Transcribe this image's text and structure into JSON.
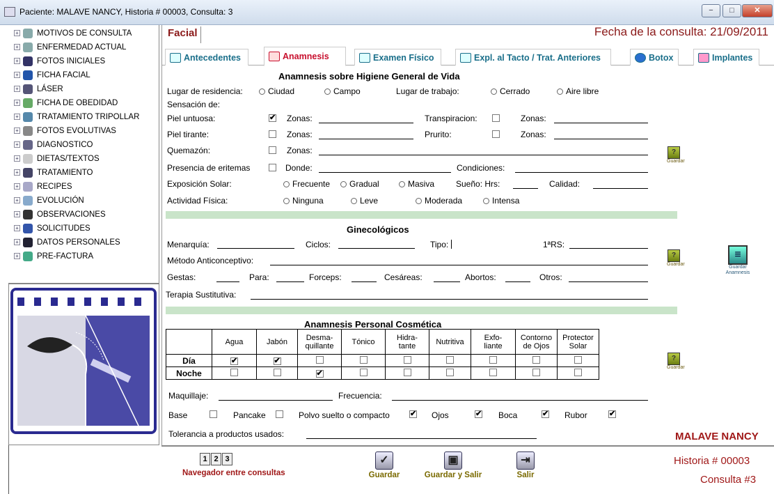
{
  "window": {
    "title": "Paciente: MALAVE  NANCY, Historia # 00003, Consulta: 3",
    "min": "−",
    "max": "□",
    "close": "✕"
  },
  "sidebar": {
    "items": [
      "MOTIVOS DE CONSULTA",
      "ENFERMEDAD ACTUAL",
      "FOTOS INICIALES",
      "FICHA FACIAL",
      "LÁSER",
      "FICHA DE OBEDIDAD",
      "TRATAMIENTO TRIPOLLAR",
      "FOTOS EVOLUTIVAS",
      "DIAGNOSTICO",
      "DIETAS/TEXTOS",
      "TRATAMIENTO",
      "RECIPES",
      "EVOLUCIÓN",
      "OBSERVACIONES",
      "SOLICITUDES",
      "DATOS PERSONALES",
      "PRE-FACTURA"
    ],
    "icons": [
      "person-icon",
      "person-icon",
      "photo-icon",
      "face-icon",
      "laser-icon",
      "scale-icon",
      "device-icon",
      "photo-icon",
      "pen-icon",
      "apple-icon",
      "check-icon",
      "doc-icon",
      "doc-icon",
      "notes-icon",
      "form-icon",
      "info-icon",
      "invoice-icon"
    ]
  },
  "header": {
    "tab": "Facial",
    "fecha_label": "Fecha de la consulta:",
    "fecha": "21/09/2011"
  },
  "tabs": [
    "Antecedentes",
    "Anamnesis",
    "Examen Físico",
    "Expl. al Tacto / Trat. Anteriores",
    "Botox",
    "Implantes"
  ],
  "higiene": {
    "title": "Anamnesis sobre Higiene General de Vida",
    "residencia": "Lugar de residencia:",
    "ciudad": "Ciudad",
    "campo": "Campo",
    "trabajo": "Lugar de trabajo:",
    "cerrado": "Cerrado",
    "aire": "Aire libre",
    "sensacion": "Sensación de:",
    "piel_untuosa": "Piel untuosa:",
    "zonas": "Zonas:",
    "transpiracion": "Transpiracion:",
    "piel_tirante": "Piel tirante:",
    "prurito": "Prurito:",
    "quemazon": "Quemazón:",
    "eritemas": "Presencia de eritemas",
    "donde": "Donde:",
    "condiciones": "Condiciones:",
    "exposicion": "Exposición Solar:",
    "frecuente": "Frecuente",
    "gradual": "Gradual",
    "masiva": "Masiva",
    "sueno": "Sueño: Hrs:",
    "calidad": "Calidad:",
    "actividad": "Actividad Física:",
    "ninguna": "Ninguna",
    "leve": "Leve",
    "moderada": "Moderada",
    "intensa": "Intensa"
  },
  "gineco": {
    "title": "Ginecológicos",
    "menarquia": "Menarquía:",
    "ciclos": "Ciclos:",
    "tipo": "Tipo:",
    "rs": "1ªRS:",
    "metodo": "Método Anticonceptivo:",
    "gestas": "Gestas:",
    "para": "Para:",
    "forceps": "Forceps:",
    "cesareas": "Cesáreas:",
    "abortos": "Abortos:",
    "otros": "Otros:",
    "terapia": "Terapia Sustitutiva:"
  },
  "cosmetica": {
    "title": "Anamnesis Personal Cosmética",
    "cols": [
      "Agua",
      "Jabón",
      "Desma-\nquillante",
      "Tónico",
      "Hidra-\ntante",
      "Nutritiva",
      "Exfo-\nliante",
      "Contorno\nde Ojos",
      "Protector\nSolar"
    ],
    "rows": [
      {
        "label": "Día",
        "checked": [
          true,
          true,
          false,
          false,
          false,
          false,
          false,
          false,
          false
        ]
      },
      {
        "label": "Noche",
        "checked": [
          false,
          false,
          true,
          false,
          false,
          false,
          false,
          false,
          false
        ]
      }
    ],
    "maquillaje": "Maquillaje:",
    "frecuencia": "Frecuencia:",
    "base": "Base",
    "pancake": "Pancake",
    "polvo": "Polvo suelto o compacto",
    "ojos": "Ojos",
    "boca": "Boca",
    "rubor": "Rubor",
    "tolerancia": "Tolerancia a productos usados:"
  },
  "buttons": {
    "guardar_small": "Guardar",
    "guardar_anamnesis": "Guardar Anamnesis",
    "guardar": "Guardar",
    "guardar_salir": "Guardar y Salir",
    "salir": "Salir"
  },
  "nav": {
    "pages": [
      "1",
      "2",
      "3"
    ],
    "label": "Navegador entre consultas"
  },
  "patient": {
    "name": "MALAVE NANCY",
    "historia": "Historia # 00003",
    "consulta": "Consulta #3"
  }
}
